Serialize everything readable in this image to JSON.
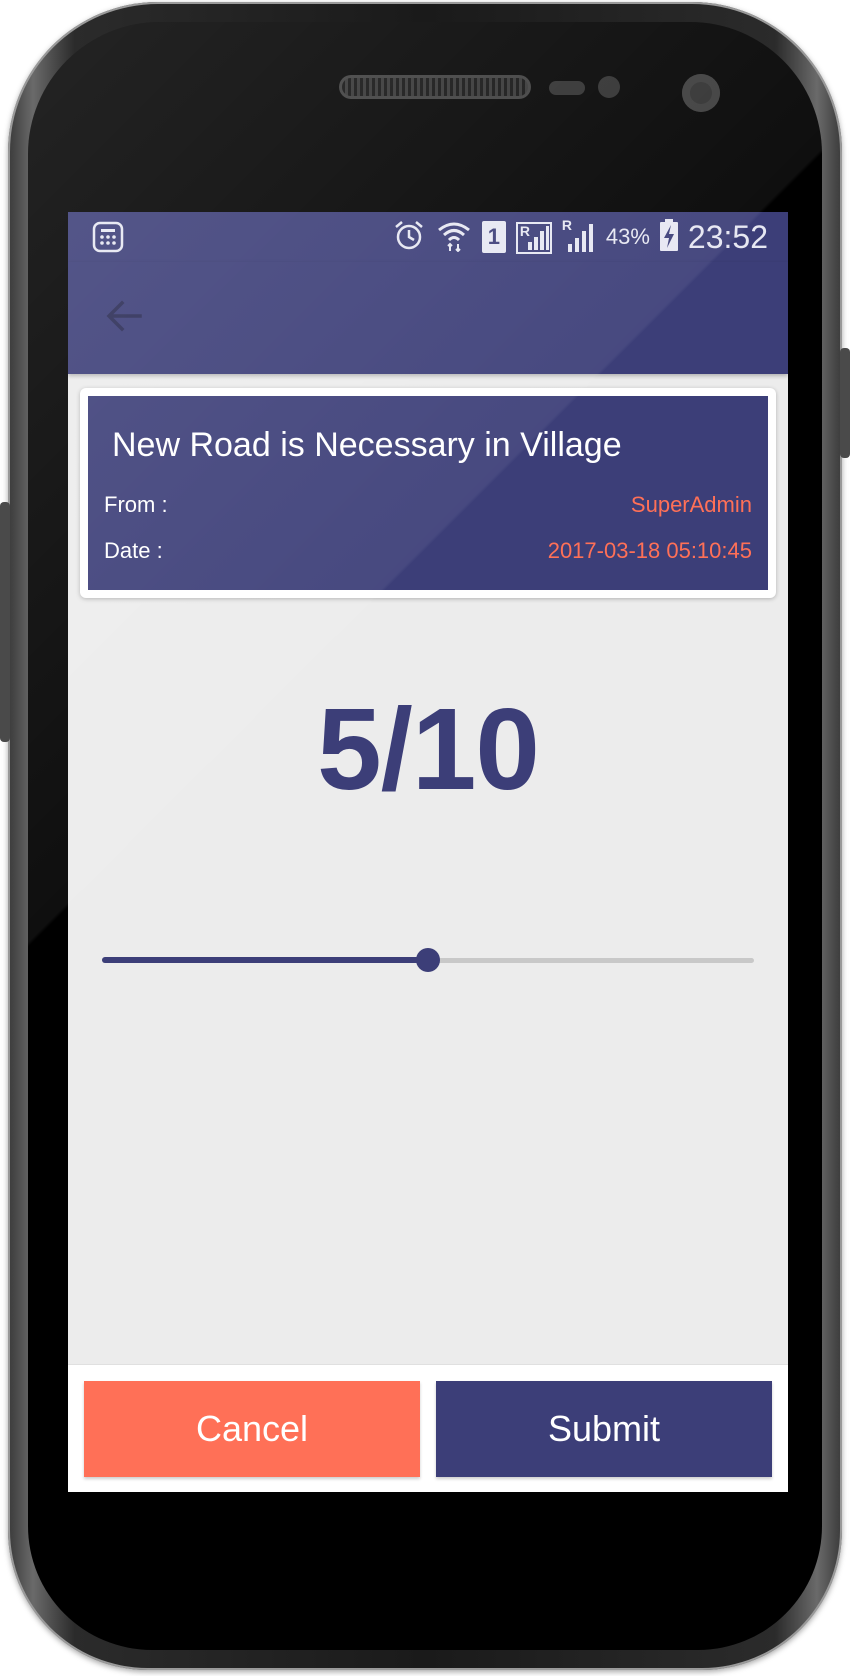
{
  "status_bar": {
    "battery": "43%",
    "time": "23:52",
    "sim_slot": "1",
    "roaming_1": "R",
    "roaming_2": "R",
    "icons": [
      "app-grid-icon",
      "alarm-icon",
      "wifi-icon",
      "sim-1-icon",
      "signal-roaming-icon",
      "signal-icon",
      "battery-charging-icon"
    ]
  },
  "app_bar": {
    "back_icon": "arrow-left-icon"
  },
  "card": {
    "title": "New Road is Necessary in Village",
    "from_label": "From :",
    "from_value": "SuperAdmin",
    "date_label": "Date :",
    "date_value": "2017-03-18 05:10:45"
  },
  "rating": {
    "score_text": "5/10",
    "value": 5,
    "max": 10
  },
  "actions": {
    "cancel_label": "Cancel",
    "submit_label": "Submit"
  },
  "colors": {
    "primary": "#3c3e78",
    "accent": "#ff7057",
    "background": "#ececec"
  }
}
